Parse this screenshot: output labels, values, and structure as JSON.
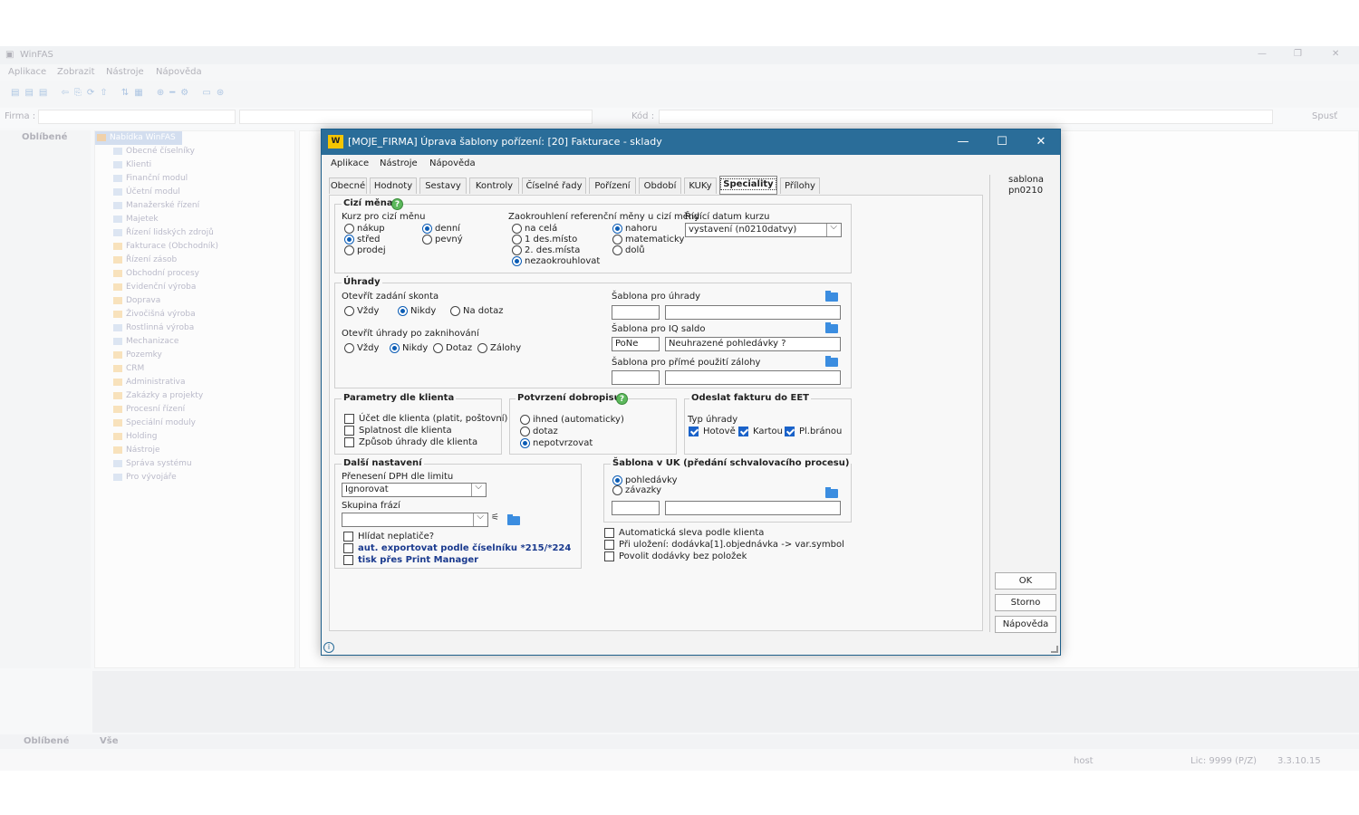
{
  "background_app": {
    "title": "WinFAS",
    "menu": [
      "Aplikace",
      "Zobrazit",
      "Nástroje",
      "Nápověda"
    ],
    "filter_firma": "Firma :",
    "filter_kod": "Kód :",
    "spustit": "Spusť",
    "left_panel_label": "Oblíbené",
    "tree_root": "Nabídka WinFAS",
    "tree_items": [
      "Obecné číselníky",
      "Klienti",
      "Finanční modul",
      "Účetní modul",
      "Manažerské řízení",
      "Majetek",
      "Řízení lidských zdrojů",
      "Fakturace (Obchodník)",
      "Řízení zásob",
      "Obchodní procesy",
      "Evidenční výroba",
      "Doprava",
      "Živočišná výroba",
      "Rostlinná výroba",
      "Mechanizace",
      "Pozemky",
      "CRM",
      "Administrativa",
      "Zakázky a projekty",
      "Procesní řízení",
      "Speciální moduly",
      "Holding",
      "Nástroje",
      "Správa systému",
      "Pro vývojáře"
    ],
    "bottom_tab_fav": "Oblíbené",
    "bottom_tab_all": "Vše",
    "status_user": "host",
    "status_lic": "Lic: 9999 (P/Z)",
    "status_version": "3.3.10.15"
  },
  "dialog": {
    "title": "[MOJE_FIRMA] Úprava šablony pořízení: [20] Fakturace - sklady",
    "menu": [
      "Aplikace",
      "Nástroje",
      "Nápověda"
    ],
    "tabs": [
      "Obecné",
      "Hodnoty",
      "Sestavy",
      "Kontroly",
      "Číselné řady",
      "Pořízení",
      "Období",
      "KUKy",
      "Speciality",
      "Přílohy"
    ],
    "side_label_1": "sablona",
    "side_label_2": "pn0210",
    "buttons": {
      "ok": "OK",
      "cancel": "Storno",
      "help": "Nápověda"
    },
    "cizi_mena": {
      "title": "Cizí měna",
      "kurz_label": "Kurz pro cizí měnu",
      "kurz_opts": [
        "nákup",
        "střed",
        "prodej"
      ],
      "kurz_selected": "střed",
      "typ_opts": [
        "denní",
        "pevný"
      ],
      "typ_selected": "denní",
      "zaokr_label": "Zaokrouhlení referenční měny u cizí měny",
      "zaokr_opts": [
        "na celá",
        "1 des.místo",
        "2. des.místa",
        "nezaokrouhlovat"
      ],
      "zaokr_selected": "nezaokrouhlovat",
      "smer_opts": [
        "nahoru",
        "matematicky",
        "dolů"
      ],
      "smer_selected": "nahoru",
      "ridici_label": "Řídící datum kurzu",
      "ridici_value": "vystavení (n0210datvy)"
    },
    "uhrady": {
      "title": "Úhrady",
      "skonto_label": "Otevřít zadání skonta",
      "skonto_opts": [
        "Vždy",
        "Nikdy",
        "Na dotaz"
      ],
      "skonto_selected": "Nikdy",
      "po_zakn_label": "Otevřít úhrady po zaknihování",
      "po_zakn_opts": [
        "Vždy",
        "Nikdy",
        "Dotaz",
        "Zálohy"
      ],
      "po_zakn_selected": "Nikdy",
      "sab_uhrady_label": "Šablona pro úhrady",
      "sab_uhrady_code": "",
      "sab_uhrady_name": "",
      "sab_iq_label": "Šablona pro IQ saldo",
      "sab_iq_code": "PoNe",
      "sab_iq_name": "Neuhrazené pohledávky ?",
      "sab_zal_label": "Šablona pro přímé použití zálohy",
      "sab_zal_code": "",
      "sab_zal_name": ""
    },
    "parametry": {
      "title": "Parametry dle klienta",
      "items": [
        "Účet dle klienta (platit, poštovní)",
        "Splatnost dle klienta",
        "Způsob úhrady dle klienta"
      ]
    },
    "dobropis": {
      "title": "Potvrzení dobropisu",
      "opts": [
        "ihned (automaticky)",
        "dotaz",
        "nepotvrzovat"
      ],
      "selected": "nepotvrzovat"
    },
    "eet": {
      "title": "Odeslat fakturu do EET",
      "typ_label": "Typ úhrady",
      "opts": [
        "Hotově",
        "Kartou",
        "Pl.bránou"
      ]
    },
    "dalsi": {
      "title": "Další nastavení",
      "dph_label": "Přenesení DPH dle limitu",
      "dph_value": "Ignorovat",
      "fraze_label": "Skupina frází",
      "fraze_value": "",
      "check_neplatice": "Hlídat neplatiče?",
      "check_export": "aut. exportovat podle číselníku *215/*224",
      "check_print": "tisk přes Print Manager"
    },
    "uk": {
      "title": "Šablona v UK (předání schvalovacího procesu)",
      "opts": [
        "pohledávky",
        "závazky"
      ],
      "selected": "pohledávky",
      "code": "",
      "name": ""
    },
    "extra_checks": [
      "Automatická sleva podle klienta",
      "Při uložení: dodávka[1].objednávka -> var.symbol",
      "Povolit dodávky bez položek"
    ]
  }
}
